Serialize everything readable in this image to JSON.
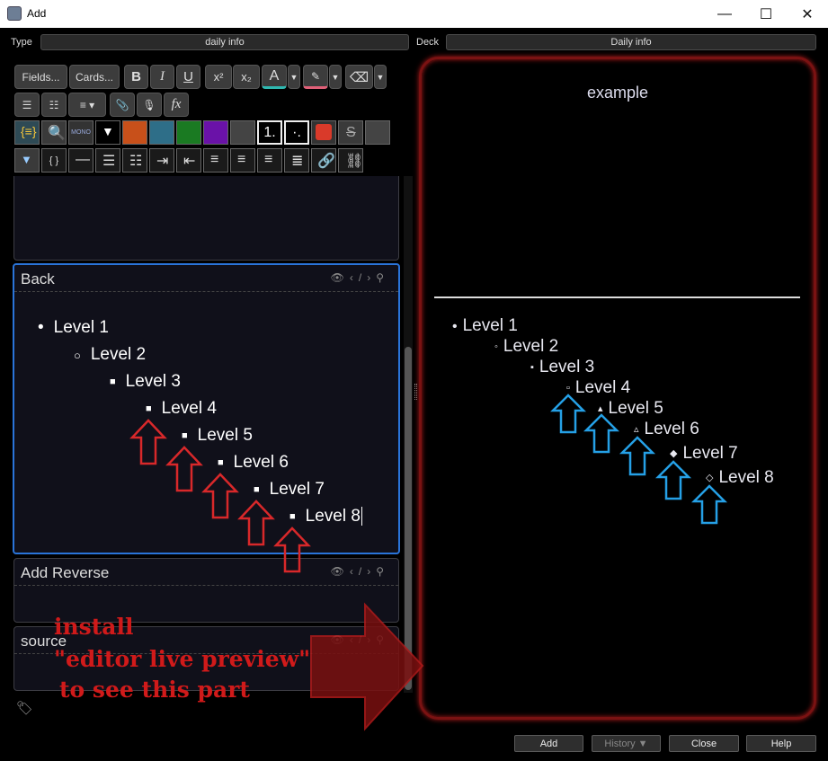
{
  "window": {
    "title": "Add",
    "minimize": "—",
    "maximize": "☐",
    "close": "✕"
  },
  "top": {
    "type_label": "Type",
    "type_value": "daily info",
    "deck_label": "Deck",
    "deck_value": "Daily info"
  },
  "toolbar": {
    "fields": "Fields...",
    "cards": "Cards...",
    "bold": "B",
    "italic": "I",
    "underline": "U",
    "superscript": "x²",
    "subscript": "x₂",
    "text_color": "A",
    "mono": "MONO",
    "ol1": "1.",
    "ol2": "·.",
    "braces": "{ }",
    "fx": "fx"
  },
  "fields": {
    "back": {
      "name": "Back"
    },
    "add_reverse": {
      "name": "Add Reverse"
    },
    "source": {
      "name": "source"
    }
  },
  "back_list": [
    "Level 1",
    "Level 2",
    "Level 3",
    "Level 4",
    "Level 5",
    "Level 6",
    "Level 7",
    "Level 8"
  ],
  "preview": {
    "title": "example",
    "list": [
      "Level 1",
      "Level 2",
      "Level 3",
      "Level 4",
      "Level 5",
      "Level 6",
      "Level 7",
      "Level 8"
    ],
    "bullets": [
      "•",
      "◦",
      "▪",
      "▫",
      "▴",
      "▵",
      "◆",
      "◇"
    ]
  },
  "annotation": {
    "line1": "install",
    "line2": "\"editor live preview\"",
    "line3": "to see this part"
  },
  "buttons": {
    "add": "Add",
    "history": "History ▼",
    "close": "Close",
    "help": "Help"
  },
  "colors": {
    "swatch_orange": "#c8501a",
    "swatch_teal": "#2e6e88",
    "swatch_green": "#1a7a22",
    "swatch_purple": "#6a12a8",
    "swatch_gray": "#444444",
    "accent_blue": "#2a74d9",
    "arrow_red": "#d8282a",
    "arrow_blue": "#25a0e6"
  }
}
